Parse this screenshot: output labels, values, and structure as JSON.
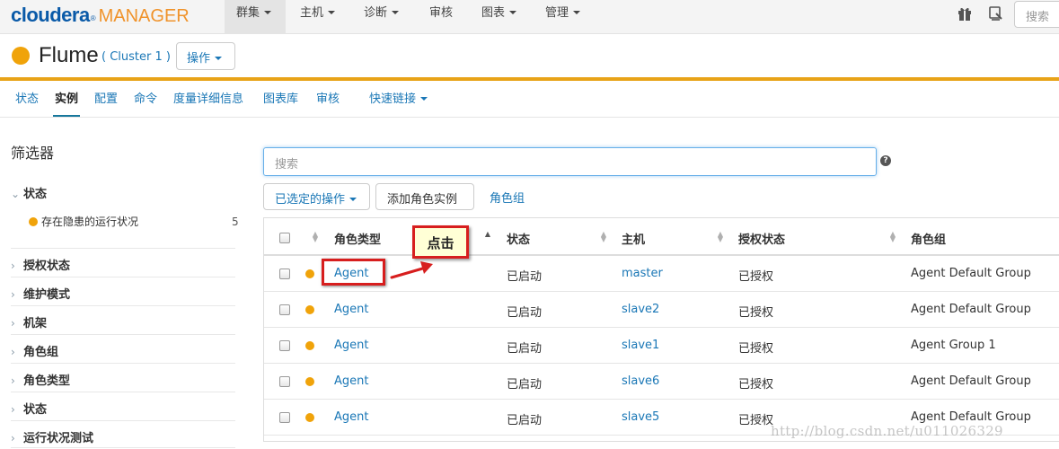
{
  "colors": {
    "brand_blue": "#0a5aa8",
    "brand_orange": "#f0932b",
    "link": "#1a77b6",
    "status_orange": "#f0a30a",
    "rule_orange": "#e8a317",
    "annotation_red": "#d71e1e"
  },
  "topnav": {
    "logo_brand": "cloudera",
    "logo_reg": "®",
    "logo_suffix": "MANAGER",
    "items": [
      {
        "label": "群集",
        "active": true
      },
      {
        "label": "主机"
      },
      {
        "label": "诊断"
      },
      {
        "label": "审核"
      },
      {
        "label": "图表"
      },
      {
        "label": "管理"
      }
    ],
    "icons": [
      "gift-icon",
      "support-icon"
    ],
    "search_placeholder": "搜索"
  },
  "service": {
    "name": "Flume",
    "cluster": "( Cluster 1 )",
    "status_icon": "status-dot-icon",
    "ops_button": "操作"
  },
  "subnav": {
    "tabs": [
      {
        "label": "状态"
      },
      {
        "label": "实例",
        "active": true
      },
      {
        "label": "配置"
      },
      {
        "label": "命令"
      },
      {
        "label": "度量详细信息"
      },
      {
        "label": "图表库"
      },
      {
        "label": "审核"
      },
      {
        "label": "快速链接",
        "dropdown": true
      }
    ]
  },
  "filters": {
    "title": "筛选器",
    "expanded_group": "状态",
    "expanded_item": {
      "label": "存在隐患的运行状况",
      "count": "5"
    },
    "groups": [
      "授权状态",
      "维护模式",
      "机架",
      "角色组",
      "角色类型",
      "状态",
      "运行状况测试"
    ]
  },
  "search": {
    "placeholder": "搜索",
    "help": "?"
  },
  "toolbar": {
    "selected_actions": "已选定的操作",
    "add_role_instances": "添加角色实例",
    "role_groups": "角色组"
  },
  "table": {
    "columns": [
      "角色类型",
      "状态",
      "主机",
      "授权状态",
      "角色组"
    ],
    "rows": [
      {
        "role_type": "Agent",
        "state": "已启动",
        "host": "master",
        "license": "已授权",
        "role_group": "Agent Default Group"
      },
      {
        "role_type": "Agent",
        "state": "已启动",
        "host": "slave2",
        "license": "已授权",
        "role_group": "Agent Default Group"
      },
      {
        "role_type": "Agent",
        "state": "已启动",
        "host": "slave1",
        "license": "已授权",
        "role_group": "Agent Group 1"
      },
      {
        "role_type": "Agent",
        "state": "已启动",
        "host": "slave6",
        "license": "已授权",
        "role_group": "Agent Default Group"
      },
      {
        "role_type": "Agent",
        "state": "已启动",
        "host": "slave5",
        "license": "已授权",
        "role_group": "Agent Default Group"
      }
    ]
  },
  "annotation": {
    "callout": "点击"
  },
  "watermark": "http://blog.csdn.net/u011026329"
}
